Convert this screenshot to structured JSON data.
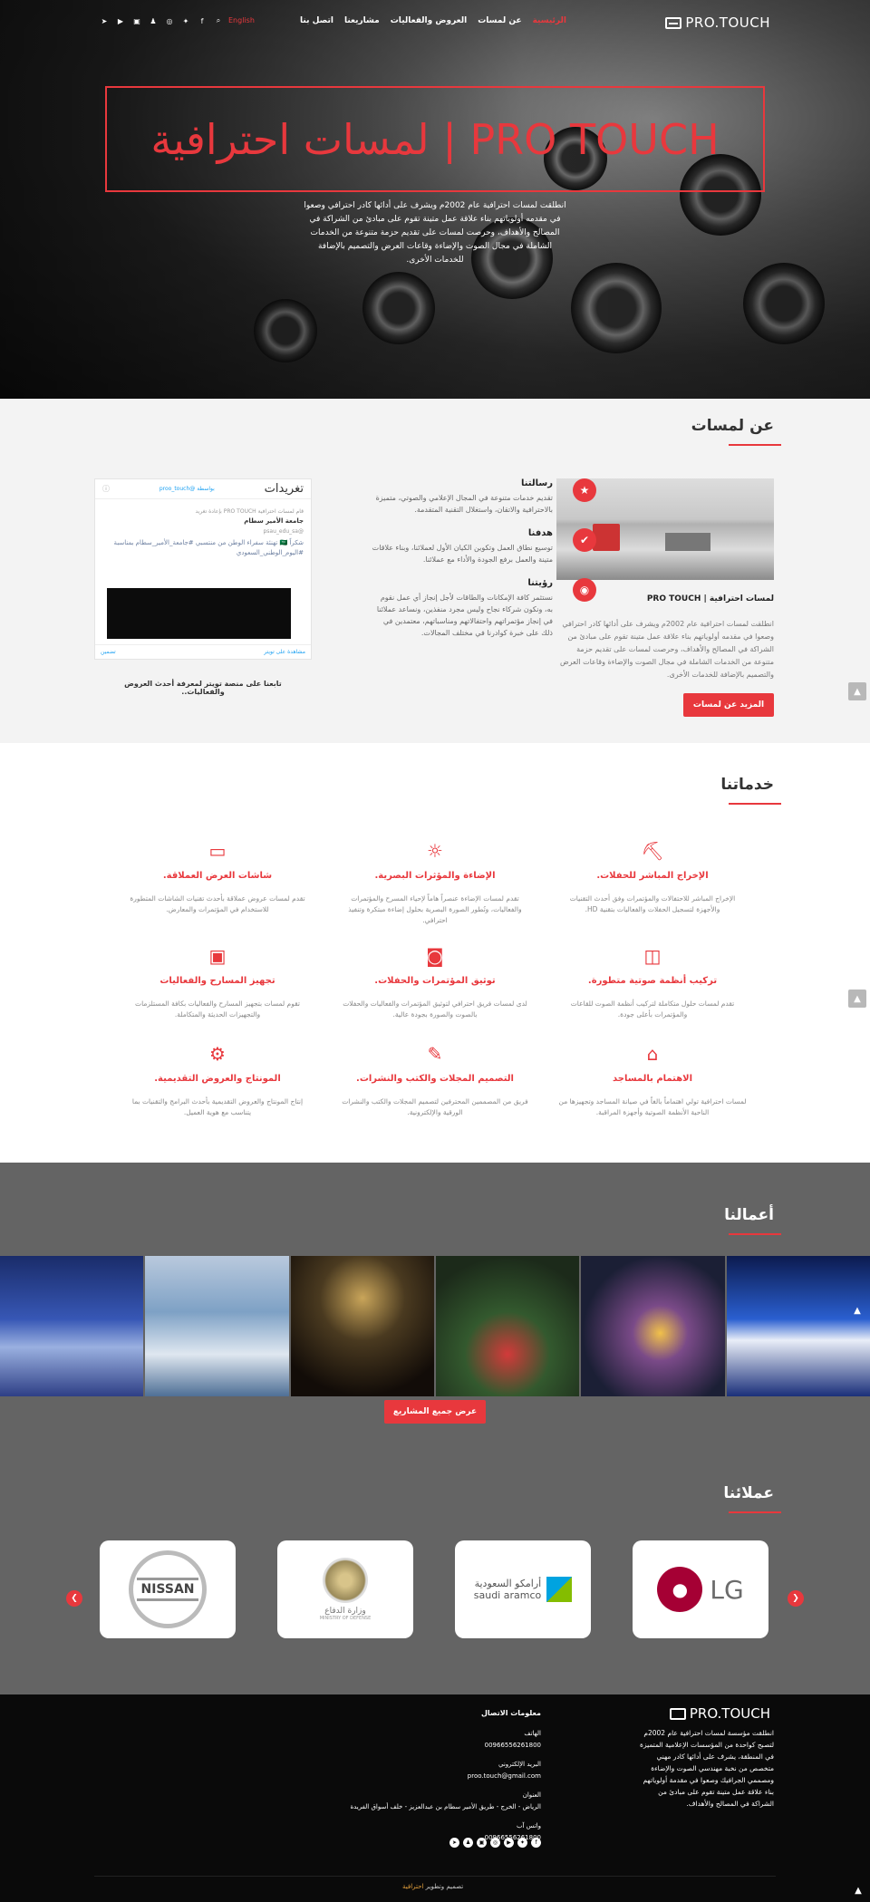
{
  "header": {
    "logo": "PRO.TOUCH",
    "menu": [
      "الرئيسية",
      "عن لمسات",
      "العروض والفعاليات",
      "مشاريعنا",
      "اتصل بنا"
    ],
    "lang": "English",
    "social_icons": [
      "telegram-icon",
      "youtube-icon",
      "youtube-alt-icon",
      "snapchat-icon",
      "instagram-icon",
      "twitter-icon",
      "facebook-icon",
      "search-icon"
    ]
  },
  "hero": {
    "title": "لمسات احترافية | PRO TOUCH",
    "text": "انطلقت لمسات احترافية عام 2002م ويشرف على أدائها كادر احترافي وصعوا في مقدمه أولوياتهم بناء علاقة عمل متينة تقوم على مبادئ من الشراكة في المصالح والأهداف، وحرصت لمسات على تقديم حزمة متنوعة من الخدمات الشاملة في مجال الصوت والإضاءة وقاعات العرض والتصميم بالإضافة للخدمات الأخرى."
  },
  "about": {
    "title": "عن لمسات",
    "heading": "لمسات احترافية | PRO TOUCH",
    "text": "انطلقت لمسات احترافية عام 2002م ويشرف على أدائها كادر احترافي وصعوا في مقدمه أولوياتهم بناء علاقة عمل متينة تقوم على مبادئ من الشراكة في المصالح والأهداف، وحرصت لمسات على تقديم حزمة متنوعة من الخدمات الشاملة في مجال الصوت والإضاءة وقاعات العرض والتصميم بالإضافة للخدمات الأخرى.",
    "more_button": "المزيد عن لمسات",
    "mission": {
      "title": "رسالتنا",
      "text": "تقديم خدمات متنوعة في المجال الإعلامي والصوتي، متميزة بالاحترافية والاتقان، واستغلال التقنية المتقدمة."
    },
    "goal": {
      "title": "هدفنا",
      "text": "توسيع نطاق العمل وتكوين الكيان الأول لعملائنا، وبناء علاقات متينة والعمل برفع الجودة والأداء مع عملائنا."
    },
    "vision": {
      "title": "رؤيتنا",
      "text": "نستثمر كافة الإمكانات والطاقات لأجل إنجاز أي عمل نقوم به، ونكون شركاء نجاح وليس مجرد منفذين، ونساعد عملائنا في إنجاز مؤتمراتهم واحتفالاتهم ومناسباتهم، معتمدين في ذلك على خبرة كوادرنا في مختلف المجالات."
    },
    "twitter": {
      "title": "تغريدات",
      "by": "بواسطة",
      "handle": "@proo_touch",
      "retweet": "قام لمسات احترافية PRO TOUCH بإعادة تغريد",
      "author": "جامعة الأمير سطام",
      "author_handle": "@psau_edu_sa",
      "tweet": "شكراً 🇸🇦 تهنئة سفراء الوطن من منتسبي #جامعة_الأمير_سطام بمناسبة #اليوم_الوطني_السعودي",
      "embed": "تضمين",
      "view_on": "مشاهدة على تويتر"
    },
    "twitter_caption": "تابعنا على منصة تويتر لمعرفة أحدث العروض والفعاليات.."
  },
  "services": {
    "title": "خدماتنا",
    "items": [
      {
        "icon": "director-chair-icon",
        "title": "الإخراج المباشر للحفلات.",
        "text": "الإخراج المباشر للاحتفالات والمؤتمرات وفق أحدث التقنيات والأجهزة لتسجيل الحفلات والفعاليات بتقنية HD."
      },
      {
        "icon": "lighting-icon",
        "title": "الإضاءة والمؤثرات البصرية.",
        "text": "تقدم لمسات الإضاءة عنصراً هاماً لإحياء المسرح والمؤتمرات والفعاليات، وتُطور الصورة البصرية بحلول إضاءة مبتكرة وتنفيذ احترافي."
      },
      {
        "icon": "screen-icon",
        "title": "شاشات العرض العملاقة.",
        "text": "تقدم لمسات عروض عملاقة بأحدث تقنيات الشاشات المتطورة للاستخدام في المؤتمرات والمعارض."
      },
      {
        "icon": "speakers-icon",
        "title": "تركيب أنظمة صوتية متطورة.",
        "text": "تقدم لمسات حلول متكاملة لتركيب أنظمة الصوت للقاعات والمؤتمرات بأعلى جودة."
      },
      {
        "icon": "camera-icon",
        "title": "توثيق المؤتمرات والحفلات.",
        "text": "لدى لمسات فريق احترافي لتوثيق المؤتمرات والفعاليات والحفلات بالصوت والصورة بجودة عالية."
      },
      {
        "icon": "stage-icon",
        "title": "تجهيز المسارح والفعاليات",
        "text": "تقوم لمسات بتجهيز المسارح والفعاليات بكافة المستلزمات والتجهيزات الحديثة والمتكاملة."
      },
      {
        "icon": "mosque-icon",
        "title": "الاهتمام بالمساجد",
        "text": "لمسات احترافية تولي اهتماماً بالغاً في صيانة المساجد وتجهيزها من الناحية الأنظمة الصوتية وأجهزة المراقبة."
      },
      {
        "icon": "design-icon",
        "title": "التصميم المجلات والكتب والنشرات.",
        "text": "فريق من المصممين المحترفين لتصميم المجلات والكتب والنشرات الورقية والإلكترونية."
      },
      {
        "icon": "film-icon",
        "title": "المونتاج والعروض التقديمية.",
        "text": "إنتاج المونتاج والعروض التقديمية بأحدث البرامج والتقنيات بما يتناسب مع هوية العميل."
      }
    ]
  },
  "works": {
    "title": "أعمالنا",
    "button": "عرض جميع المشاريع"
  },
  "clients": {
    "title": "عملائنا",
    "logos": [
      {
        "name": "NISSAN"
      },
      {
        "name": "وزارة الدفاع",
        "sub": "MINISTRY OF DEFENSE"
      },
      {
        "name": "أرامكو السعودية",
        "sub": "saudi aramco"
      },
      {
        "name": "LG"
      }
    ]
  },
  "footer": {
    "logo": "PRO.TOUCH",
    "about": "انطلقت مؤسسة لمسات احترافية عام 2002م لتصبح كواحدة من المؤسسات الإعلامية المتميزة في المنطقة، يشرف على أدائها كادر مهني متخصص من نخبة مهندسي الصوت والإضاءة ومصممي الجرافيك وصعوا في مقدمة أولوياتهم بناء علاقة عمل متينة تقوم على مبادئ من الشراكة في المصالح والأهداف.",
    "contact_title": "معلومات الاتصال",
    "phone_label": "الهاتف",
    "phone": "00966556261800",
    "email_label": "البريد الإلكتروني",
    "email": "proo.touch@gmail.com",
    "address_label": "العنوان",
    "address": "الرياض - الخرج - طريق الأمير سطام بن عبدالعزيز - خلف أسواق الفريدة",
    "whatsapp_label": "واتس آب",
    "whatsapp": "00966556261800",
    "copyright": "تصميم وتطوير",
    "copyright_link": "احترافية",
    "social": [
      "facebook-icon",
      "twitter-icon",
      "youtube-icon",
      "instagram-icon",
      "youtube-alt-icon",
      "snapchat-icon",
      "telegram-icon"
    ]
  },
  "colors": {
    "accent": "#e8383d",
    "works_bg": "#646464",
    "about_bg": "#f3f3f3",
    "footer_bg": "#0a0a0a"
  }
}
